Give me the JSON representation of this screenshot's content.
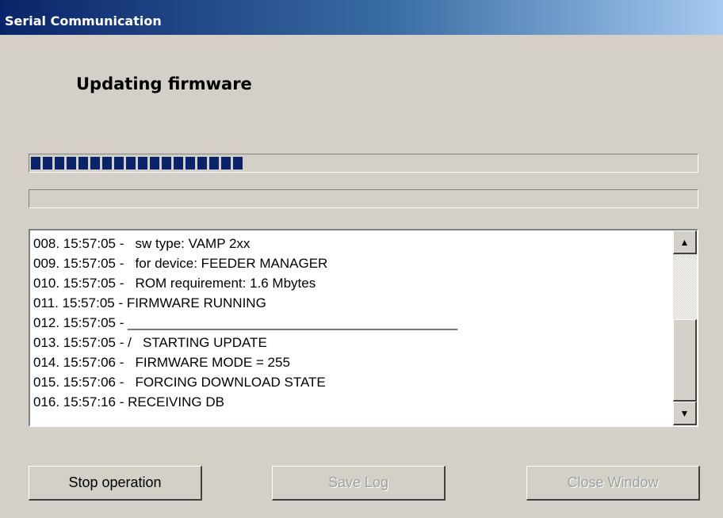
{
  "window": {
    "title": "Serial Communication"
  },
  "main": {
    "heading": "Updating firmware"
  },
  "progress": {
    "main_fraction": 0.32,
    "sub_fraction": 0.0
  },
  "log": {
    "lines": [
      "008. 15:57:05 -   sw type: VAMP 2xx",
      "009. 15:57:05 -   for device: FEEDER MANAGER",
      "010. 15:57:05 -   ROM requirement: 1.6 Mbytes",
      "011. 15:57:05 - FIRMWARE RUNNING",
      "012. 15:57:05 - ____________________________________________",
      "013. 15:57:05 - /   STARTING UPDATE",
      "014. 15:57:06 -   FIRMWARE MODE = 255",
      "015. 15:57:06 -   FORCING DOWNLOAD STATE",
      "016. 15:57:16 - RECEIVING DB"
    ],
    "scroll_up_glyph": "▲",
    "scroll_down_glyph": "▼"
  },
  "buttons": {
    "stop": "Stop operation",
    "save": "Save Log",
    "close": "Close Window"
  }
}
